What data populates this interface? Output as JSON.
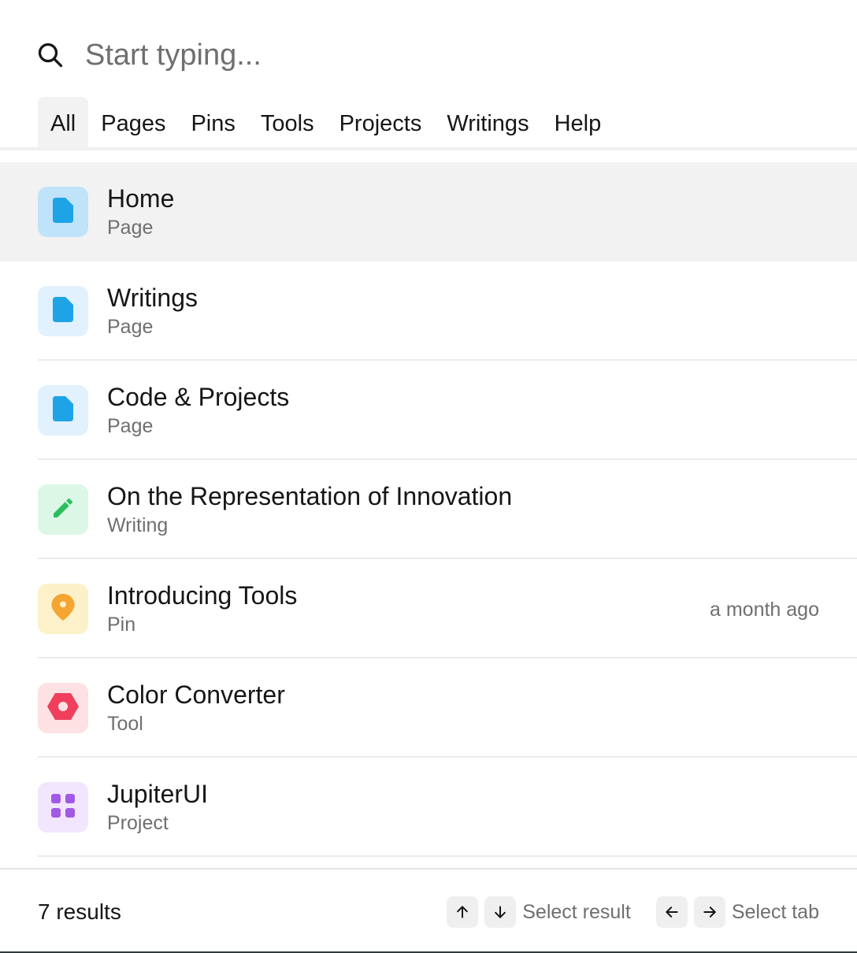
{
  "search": {
    "placeholder": "Start typing...",
    "value": "",
    "icon": "search-icon"
  },
  "tabs": [
    {
      "label": "All",
      "active": true
    },
    {
      "label": "Pages",
      "active": false
    },
    {
      "label": "Pins",
      "active": false
    },
    {
      "label": "Tools",
      "active": false
    },
    {
      "label": "Projects",
      "active": false
    },
    {
      "label": "Writings",
      "active": false
    },
    {
      "label": "Help",
      "active": false
    }
  ],
  "results": [
    {
      "title": "Home",
      "type": "Page",
      "meta": "",
      "icon": "page-icon",
      "tile_color": "#bfe3f8",
      "icon_color": "#1ea3e6",
      "selected": true
    },
    {
      "title": "Writings",
      "type": "Page",
      "meta": "",
      "icon": "page-icon",
      "tile_color": "#e1f1fd",
      "icon_color": "#1ea3e6",
      "selected": false
    },
    {
      "title": "Code & Projects",
      "type": "Page",
      "meta": "",
      "icon": "page-icon",
      "tile_color": "#e1f1fd",
      "icon_color": "#1ea3e6",
      "selected": false
    },
    {
      "title": "On the Representation of Innovation",
      "type": "Writing",
      "meta": "",
      "icon": "pencil-icon",
      "tile_color": "#dcf7e6",
      "icon_color": "#2bbf5f",
      "selected": false
    },
    {
      "title": "Introducing Tools",
      "type": "Pin",
      "meta": "a month ago",
      "icon": "map-pin-icon",
      "tile_color": "#fdf1c9",
      "icon_color": "#f4a532",
      "selected": false
    },
    {
      "title": "Color Converter",
      "type": "Tool",
      "meta": "",
      "icon": "hexagon-tool-icon",
      "tile_color": "#fde1e3",
      "icon_color": "#ef3f5c",
      "selected": false
    },
    {
      "title": "JupiterUI",
      "type": "Project",
      "meta": "",
      "icon": "grid-icon",
      "tile_color": "#f1e6fd",
      "icon_color": "#a259e6",
      "selected": false
    }
  ],
  "footer": {
    "count": "7 results",
    "select_result_label": "Select result",
    "select_tab_label": "Select tab"
  }
}
